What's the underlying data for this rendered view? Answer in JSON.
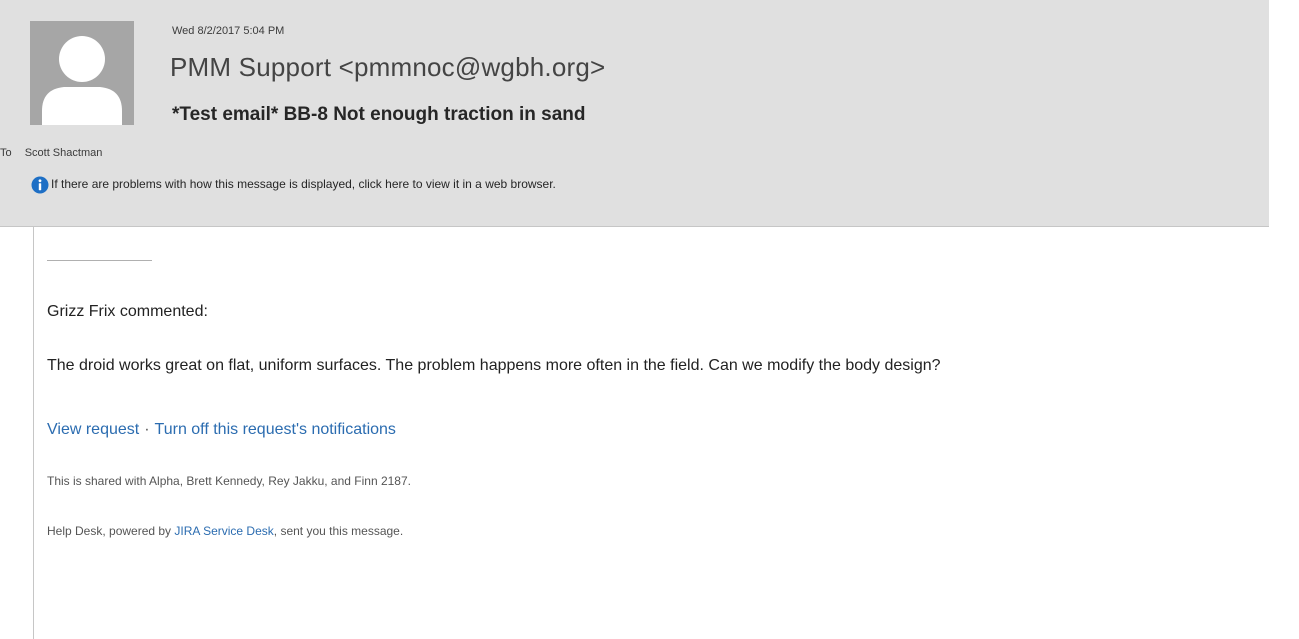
{
  "header": {
    "date": "Wed 8/2/2017 5:04 PM",
    "sender": "PMM Support <pmmnoc@wgbh.org>",
    "subject": "*Test email* BB-8 Not enough traction in sand",
    "to_label": "To",
    "to_name": "Scott Shactman",
    "info_text": "If there are problems with how this message is displayed, click here to view it in a web browser.",
    "avatar_icon": "person-placeholder-icon",
    "info_icon": "info-circle-icon"
  },
  "body": {
    "separator": "",
    "commenter": "Grizz Frix commented:",
    "comment": "The droid works great on flat, uniform surfaces. The problem happens more often in the field. Can we modify the body design?",
    "view_request": "View request",
    "link_separator": "·",
    "turn_off": "Turn off this request's notifications",
    "shared_with": "This is shared with Alpha, Brett Kennedy, Rey Jakku, and Finn 2187.",
    "footer_prefix": "Help Desk, powered by ",
    "footer_link": "JIRA Service Desk",
    "footer_suffix": ", sent you this message."
  },
  "colors": {
    "header_bg": "#e0e0e0",
    "link": "#2b6cb0",
    "info_icon": "#1e6fc5",
    "avatar_bg": "#a6a6a6"
  }
}
